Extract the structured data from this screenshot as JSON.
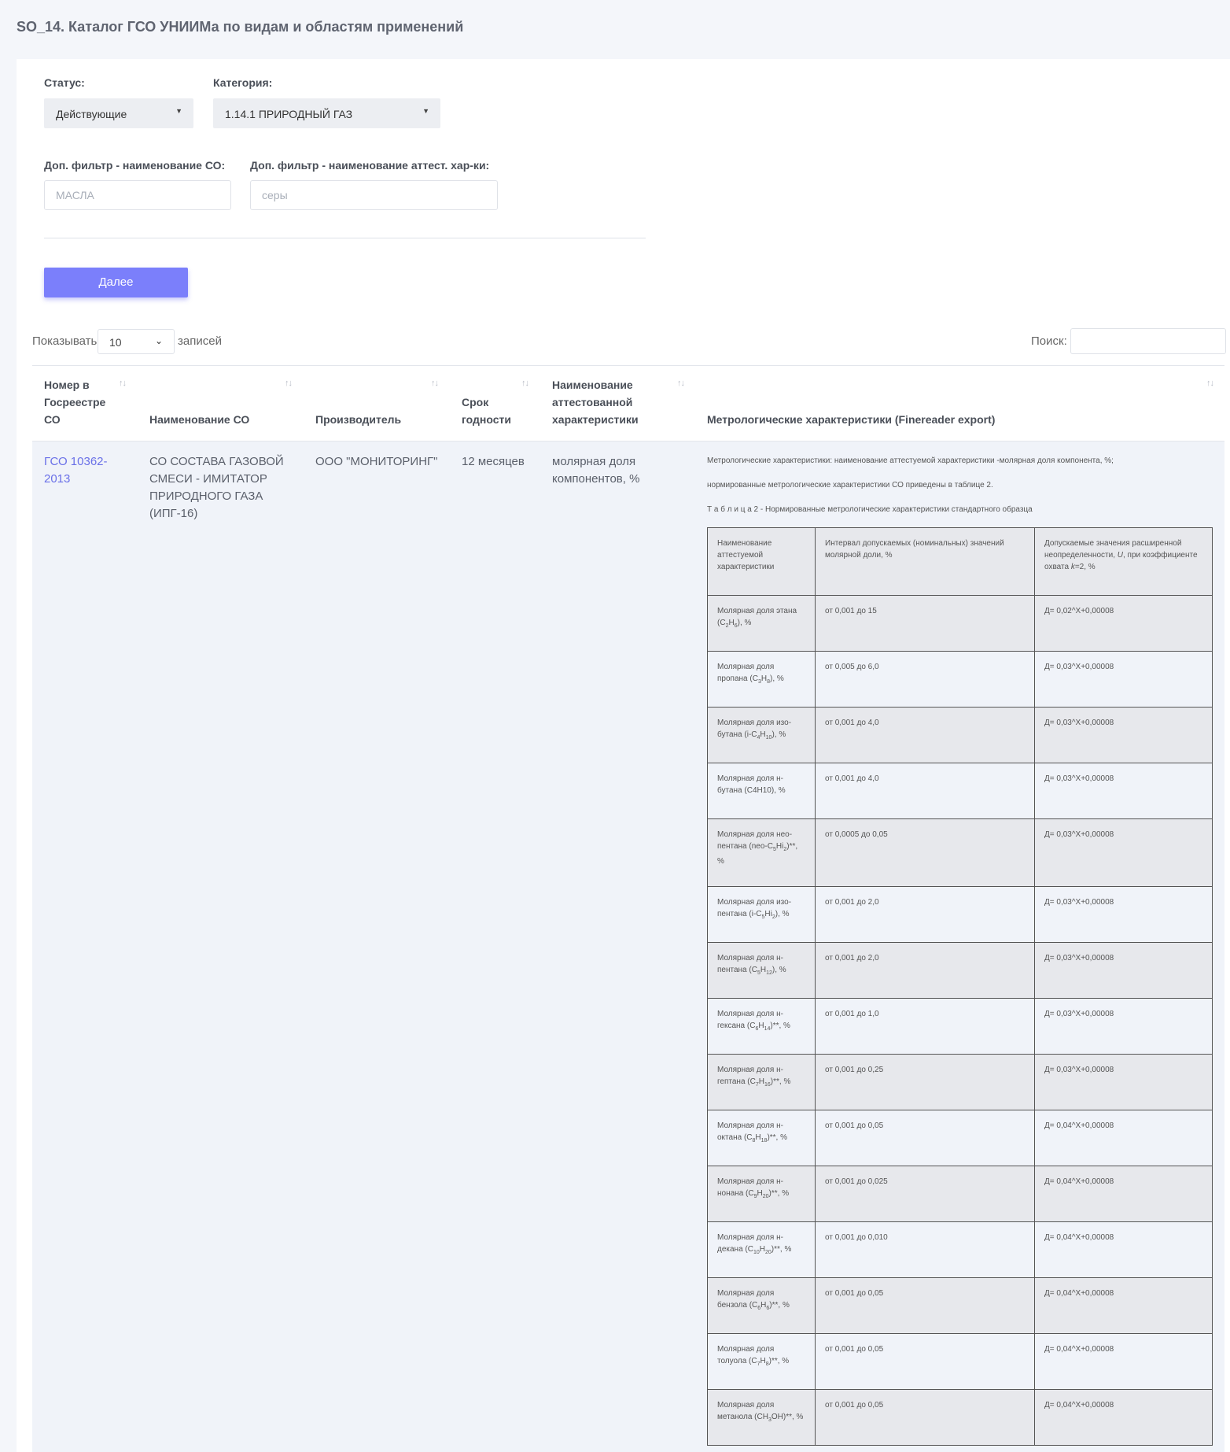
{
  "page_title": "SO_14. Каталог ГСО УНИИМа по видам и областям применений",
  "filters": {
    "status_label": "Статус:",
    "status_value": "Действующие",
    "category_label": "Категория:",
    "category_value": "1.14.1 ПРИРОДНЫЙ ГАЗ",
    "name_filter_label": "Доп. фильтр - наименование СО:",
    "name_filter_placeholder": "МАСЛА",
    "char_filter_label": "Доп. фильтр - наименование аттест. хар-ки:",
    "char_filter_placeholder": "серы",
    "next_button": "Далее"
  },
  "table_controls": {
    "show_label": "Показывать",
    "page_length": "10",
    "records_label": "записей",
    "search_label": "Поиск:"
  },
  "columns": {
    "reg_number": "Номер в Госреестре СО",
    "name": "Наименование СО",
    "manufacturer": "Производитель",
    "shelf_life": "Срок годности",
    "attested_char": "Наименование аттестованной характеристики",
    "metro": "Метрологические характеристики (Finereader export)"
  },
  "row": {
    "reg_number": "ГСО 10362-2013",
    "name": "СО СОСТАВА ГАЗОВОЙ СМЕСИ - ИМИТАТОР ПРИРОДНОГО ГАЗА (ИПГ-16)",
    "manufacturer": "ООО \"МОНИТОРИНГ\"",
    "shelf_life": "12 месяцев",
    "attested_char": "молярная доля компонентов, %",
    "metro_line1": "Метрологические характеристики: наименование аттестуемой характеристики -молярная доля компонента, %;",
    "metro_line2": "нормированные метрологические характеристики СО приведены в таблице 2.",
    "metro_line3": "Т а б л и ц а 2 - Нормированные метрологические характеристики стандартного образца",
    "inner_head": {
      "c1": "Наименование аттестуемой характеристики",
      "c2": "Интервал допускаемых (номинальных) значений молярной доли, %",
      "c3a": "Допускаемые значения расширенной неопределенности, ",
      "c3u": "U",
      "c3b": ", при коэффициенте охвата ",
      "c3k": "k",
      "c3c": "=2, %"
    },
    "inner_rows": [
      {
        "name_pre": "Молярная доля этана (C",
        "s1": "2",
        "mid": "H",
        "s2": "6",
        "name_post": "), %",
        "range": "от 0,001 до 15",
        "uncert": "Д= 0,02^X+0,00008"
      },
      {
        "name_pre": "Молярная доля пропана (C",
        "s1": "3",
        "mid": "H",
        "s2": "8",
        "name_post": "), %",
        "range": "от 0,005 до 6,0",
        "uncert": "Д= 0,03^X+0,00008"
      },
      {
        "name_pre": "Молярная доля изо-бутана (i-C",
        "s1": "4",
        "mid": "H",
        "s2": "10",
        "name_post": "), %",
        "range": "от 0,001 до 4,0",
        "uncert": "Д= 0,03^X+0,00008"
      },
      {
        "name_pre": "Молярная доля н-бутана (C4H10), %",
        "s1": "",
        "mid": "",
        "s2": "",
        "name_post": "",
        "range": "от 0,001 до 4,0",
        "uncert": "Д= 0,03^X+0,00008"
      },
      {
        "name_pre": "Молярная доля нео-пентана (neo-C",
        "s1": "5",
        "mid": "Hi",
        "s2": "2",
        "name_post": ")**, %",
        "range": "от 0,0005 до 0,05",
        "uncert": "Д= 0,03^X+0,00008"
      },
      {
        "name_pre": "Молярная доля изо-пентана (i-C",
        "s1": "5",
        "mid": "Hi",
        "s2": "2",
        "name_post": "), %",
        "range": "от 0,001 до 2,0",
        "uncert": "Д= 0,03^X+0,00008"
      },
      {
        "name_pre": "Молярная доля н-пентана (C",
        "s1": "5",
        "mid": "H",
        "s2": "12",
        "name_post": "), %",
        "range": "от 0,001 до 2,0",
        "uncert": "Д= 0,03^X+0,00008"
      },
      {
        "name_pre": "Молярная доля н-гексана (C",
        "s1": "6",
        "mid": "H",
        "s2": "14",
        "name_post": ")**, %",
        "range": "от 0,001 до 1,0",
        "uncert": "Д= 0,03^X+0,00008"
      },
      {
        "name_pre": "Молярная доля н-гептана (C",
        "s1": "7",
        "mid": "H",
        "s2": "16",
        "name_post": ")**, %",
        "range": "от 0,001 до 0,25",
        "uncert": "Д= 0,03^X+0,00008"
      },
      {
        "name_pre": "Молярная доля н-октана (C",
        "s1": "8",
        "mid": "H",
        "s2": "18",
        "name_post": ")**, %",
        "range": "от 0,001 до 0,05",
        "uncert": "Д= 0,04^X+0,00008"
      },
      {
        "name_pre": "Молярная доля н-нонана (C",
        "s1": "9",
        "mid": "H",
        "s2": "20",
        "name_post": ")**, %",
        "range": "от 0,001 до 0,025",
        "uncert": "Д= 0,04^X+0,00008"
      },
      {
        "name_pre": "Молярная доля н-декана (C",
        "s1": "10",
        "mid": "H",
        "s2": "20",
        "name_post": ")**, %",
        "range": "от 0,001 до 0,010",
        "uncert": "Д= 0,04^X+0,00008"
      },
      {
        "name_pre": "Молярная доля бензола (C",
        "s1": "6",
        "mid": "H",
        "s2": "6",
        "name_post": ")**, %",
        "range": "от 0,001 до 0,05",
        "uncert": "Д= 0,04^X+0,00008"
      },
      {
        "name_pre": "Молярная доля толуола (C",
        "s1": "7",
        "mid": "H",
        "s2": "8",
        "name_post": ")**, %",
        "range": "от 0,001 до 0,05",
        "uncert": "Д= 0,04^X+0,00008"
      },
      {
        "name_pre": "Молярная доля метанола (CH",
        "s1": "3",
        "mid": "OH",
        "s2": "",
        "name_post": ")**, %",
        "range": "от 0,001 до 0,05",
        "uncert": "Д= 0,04^X+0,00008"
      }
    ]
  }
}
